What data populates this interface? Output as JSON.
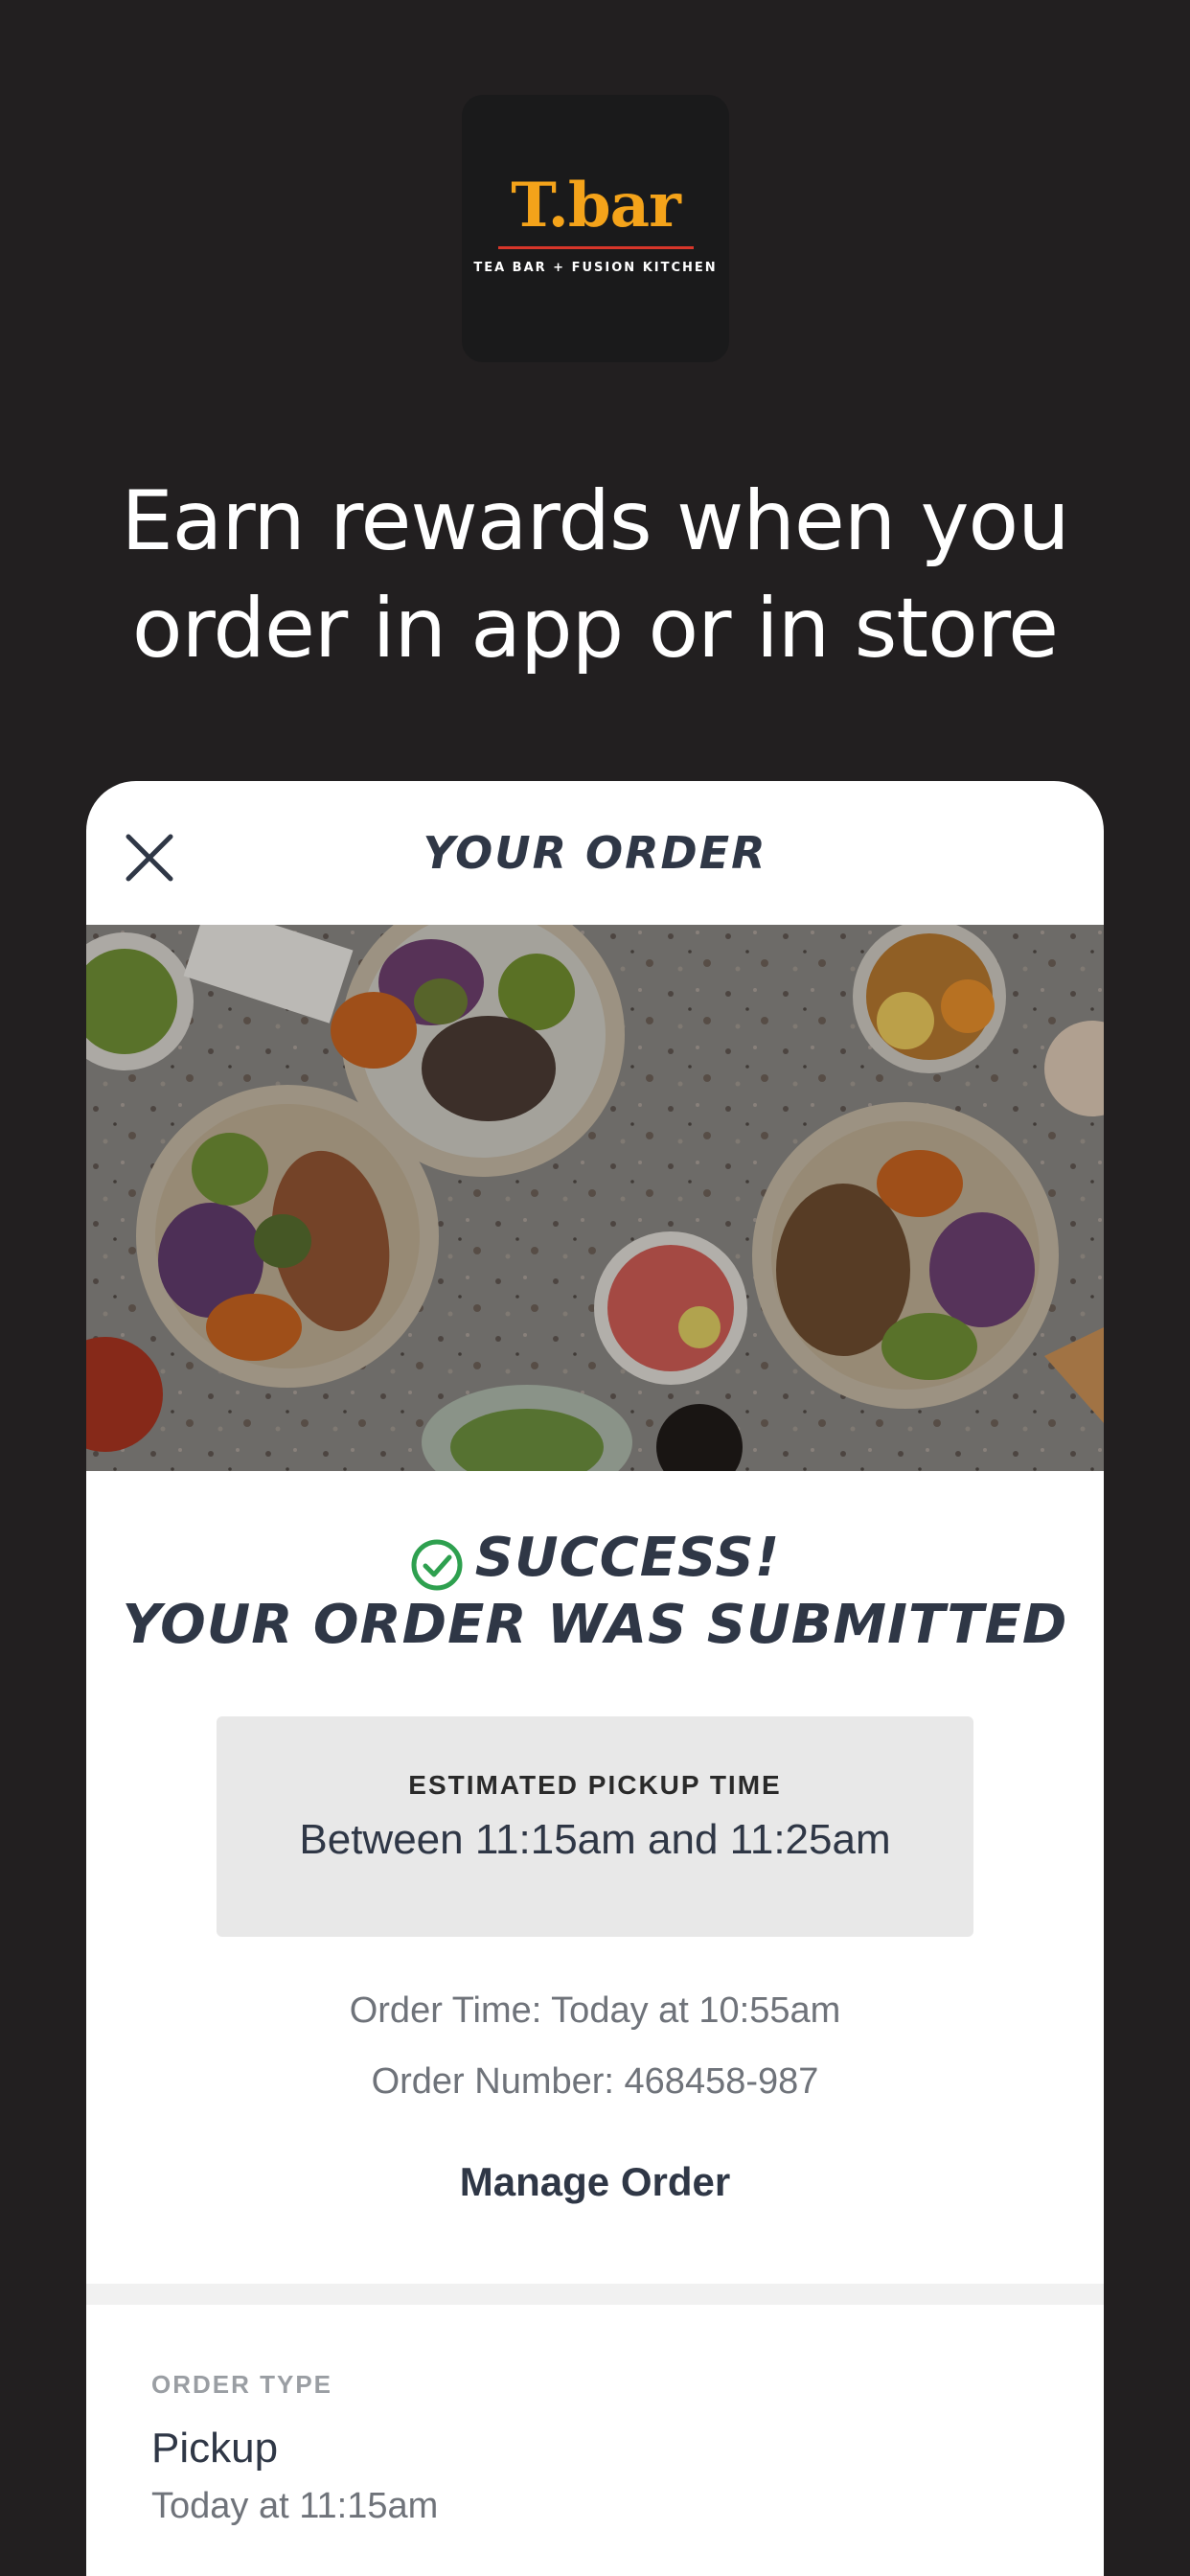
{
  "brand": {
    "logo_text": "T.bar",
    "logo_tagline": "TEA BAR + FUSION KITCHEN",
    "accent_color": "#f4a31a",
    "rule_color": "#d8362a"
  },
  "headline": "Earn rewards when you order in app or in store",
  "card": {
    "title": "YOUR ORDER",
    "close_icon": "close-icon",
    "success_line1": "SUCCESS!",
    "success_line2": "YOUR ORDER WAS SUBMITTED",
    "check_color": "#2ea04f",
    "pickup": {
      "label": "ESTIMATED PICKUP TIME",
      "value": "Between 11:15am and 11:25am"
    },
    "order_time": "Order Time: Today at 10:55am",
    "order_number": "Order Number: 468458-987",
    "manage_label": "Manage Order",
    "order_type": {
      "label": "ORDER TYPE",
      "value": "Pickup",
      "time": "Today at 11:15am"
    }
  }
}
